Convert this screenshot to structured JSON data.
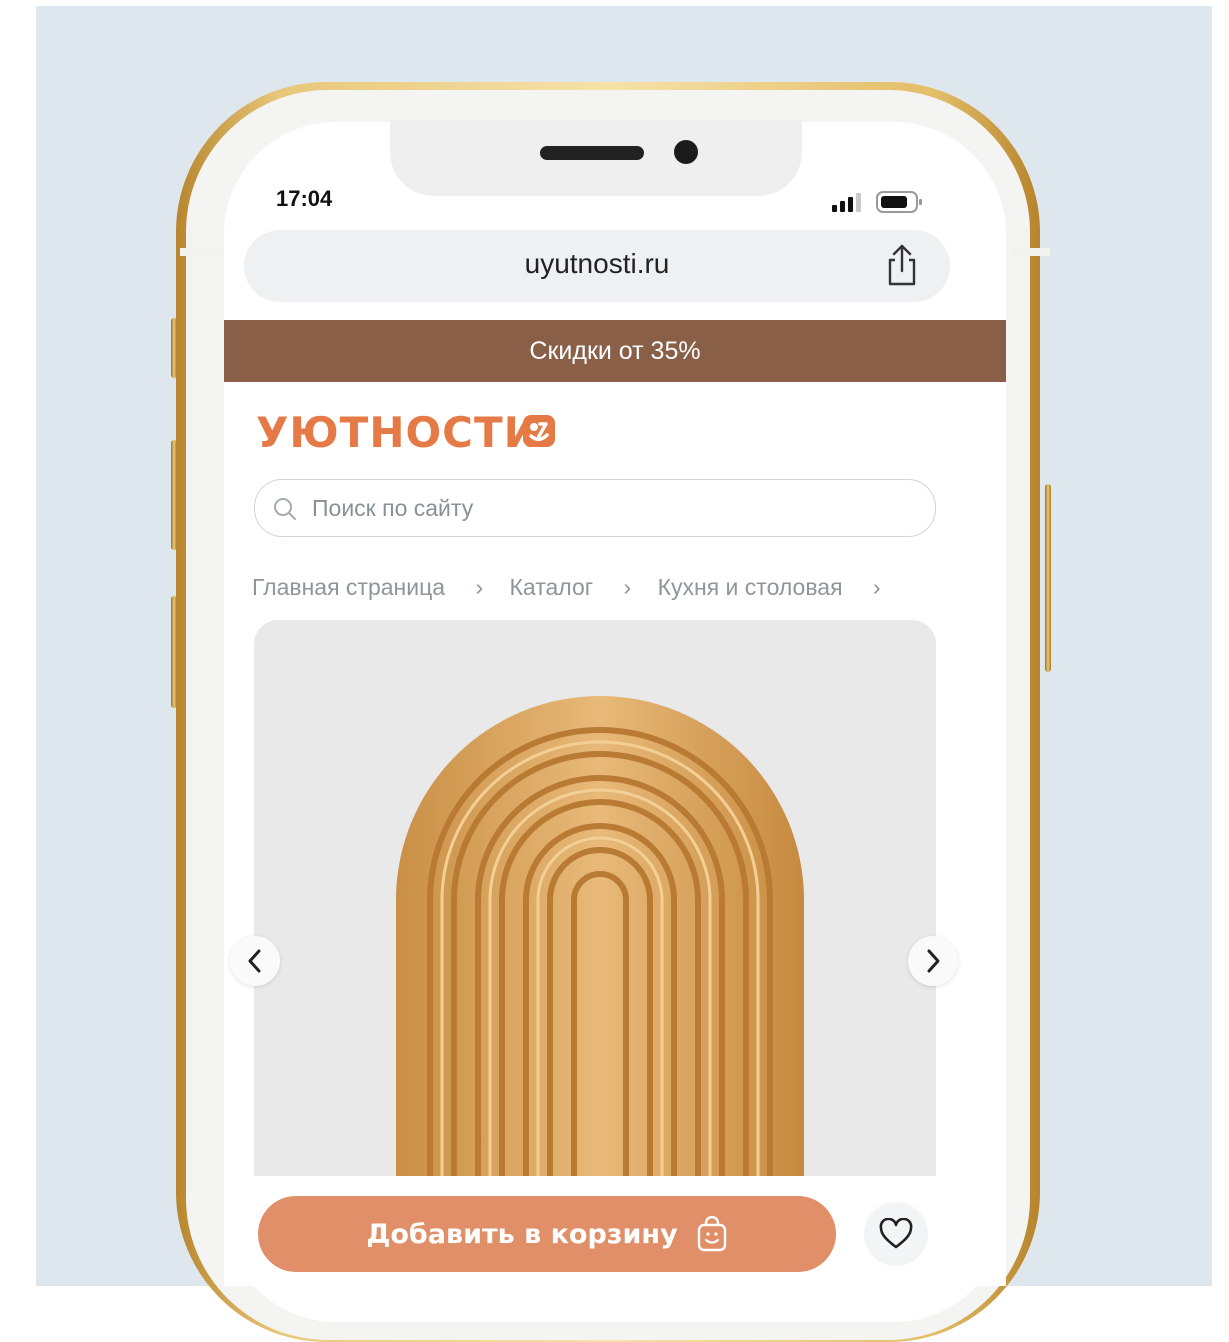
{
  "status": {
    "time": "17:04"
  },
  "browser": {
    "url": "uyutnosti.ru"
  },
  "promo": {
    "text": "Скидки от 35%"
  },
  "brand": {
    "name": "УЮТНОСТИ",
    "color": "#e57a47"
  },
  "search": {
    "placeholder": "Поиск по сайту"
  },
  "breadcrumb": {
    "items": [
      {
        "label": "Главная страница"
      },
      {
        "label": "Каталог"
      },
      {
        "label": "Кухня и столовая"
      }
    ],
    "separator": "›"
  },
  "product": {
    "cart_label": "Добавить в корзину"
  },
  "colors": {
    "promo_bg": "#8a5f48",
    "cart_button": "#e08f68",
    "phone_frame": "#e3bd68"
  },
  "icons": [
    "signal-icon",
    "battery-icon",
    "share-icon",
    "search-icon",
    "chevron-left-icon",
    "chevron-right-icon",
    "shopping-bag-icon",
    "heart-icon"
  ]
}
